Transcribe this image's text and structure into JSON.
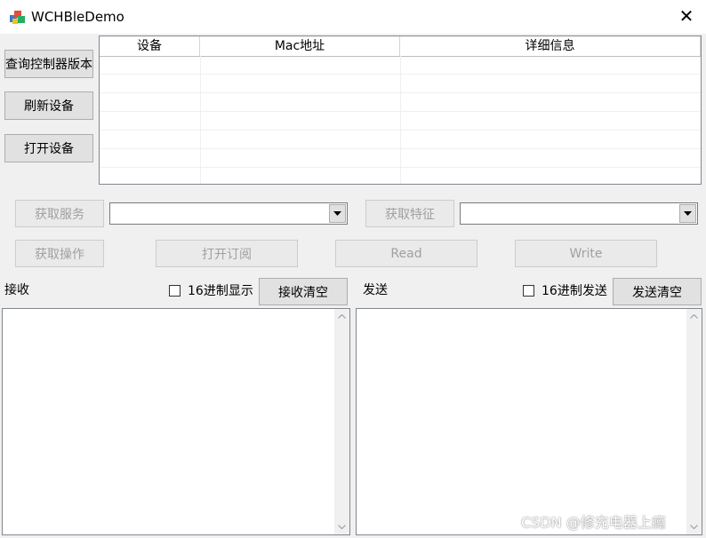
{
  "window": {
    "title": "WCHBleDemo",
    "close_glyph": "✕"
  },
  "left_buttons": {
    "query_version": "查询控制器版本",
    "refresh": "刷新设备",
    "open_device": "打开设备"
  },
  "device_list": {
    "columns": [
      "设备",
      "Mac地址",
      "详细信息"
    ],
    "rows": []
  },
  "controls": {
    "get_service": "获取服务",
    "get_characteristic": "获取特征",
    "get_operation": "获取操作",
    "subscribe": "打开订阅",
    "read": "Read",
    "write": "Write",
    "service_combo_value": "",
    "characteristic_combo_value": ""
  },
  "receive": {
    "label": "接收",
    "hex_label": "16进制显示",
    "clear": "接收清空",
    "text": ""
  },
  "send": {
    "label": "发送",
    "hex_label": "16进制发送",
    "clear": "发送清空",
    "text": ""
  },
  "watermark": "CSDN @修充电器上瘾",
  "icons": {
    "app": "app-icon",
    "close": "close-icon",
    "dropdown": "chevron-down-icon"
  }
}
